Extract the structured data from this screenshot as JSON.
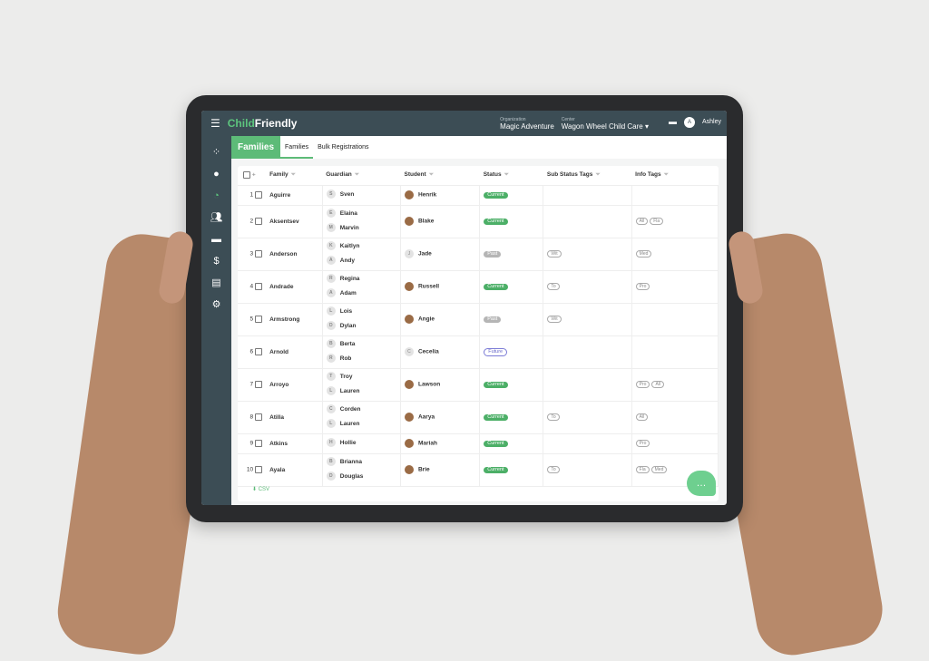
{
  "app": {
    "logo": "ChildFriendly",
    "org_label": "Organization",
    "org": "Magic Adventure",
    "center_label": "Center",
    "center": "Wagon Wheel Child Care",
    "user_initial": "A",
    "user": "Ashley"
  },
  "sidebar": {
    "items": [
      "apps-icon",
      "check-in-icon",
      "reports-icon",
      "people-icon",
      "messages-icon",
      "billing-icon",
      "documents-icon",
      "settings-icon"
    ]
  },
  "subbar": {
    "section": "Families",
    "tabs": [
      "Families",
      "Bulk Registrations"
    ]
  },
  "table": {
    "columns": [
      "Family",
      "Guardian",
      "Student",
      "Status",
      "Sub Status Tags",
      "Info Tags"
    ],
    "rows": [
      {
        "n": "1",
        "family": "Aguirre",
        "guardians": [
          "Sven"
        ],
        "student": "Henrik",
        "photo": true,
        "status": "Current",
        "sub": [],
        "info": []
      },
      {
        "n": "2",
        "family": "Aksentsev",
        "guardians": [
          "Elaina",
          "Marvin"
        ],
        "student": "Blake",
        "photo": true,
        "status": "Current",
        "sub": [],
        "info": [
          "All",
          "Fla"
        ]
      },
      {
        "n": "3",
        "family": "Anderson",
        "guardians": [
          "Kaitlyn",
          "Andy"
        ],
        "student": "Jade",
        "photo": false,
        "status": "Past",
        "sub": [
          "Wit"
        ],
        "info": [
          "Med"
        ]
      },
      {
        "n": "4",
        "family": "Andrade",
        "guardians": [
          "Regina",
          "Adam"
        ],
        "student": "Russell",
        "photo": true,
        "status": "Current",
        "sub": [
          "To"
        ],
        "info": [
          "Pro"
        ]
      },
      {
        "n": "5",
        "family": "Armstrong",
        "guardians": [
          "Lois",
          "Dylan"
        ],
        "student": "Angie",
        "photo": true,
        "status": "Past",
        "sub": [
          "Wit"
        ],
        "info": []
      },
      {
        "n": "6",
        "family": "Arnold",
        "guardians": [
          "Berta",
          "Rob"
        ],
        "student": "Cecelia",
        "photo": false,
        "status": "Future",
        "sub": [],
        "info": []
      },
      {
        "n": "7",
        "family": "Arroyo",
        "guardians": [
          "Troy",
          "Lauren"
        ],
        "student": "Lawson",
        "photo": true,
        "status": "Current",
        "sub": [],
        "info": [
          "Pro",
          "All"
        ]
      },
      {
        "n": "8",
        "family": "Atilla",
        "guardians": [
          "Corden",
          "Lauren"
        ],
        "student": "Aarya",
        "photo": true,
        "status": "Current",
        "sub": [
          "To"
        ],
        "info": [
          "All"
        ]
      },
      {
        "n": "9",
        "family": "Atkins",
        "guardians": [
          "Hollie"
        ],
        "student": "Mariah",
        "photo": true,
        "status": "Current",
        "sub": [],
        "info": [
          "Pro"
        ]
      },
      {
        "n": "10",
        "family": "Ayala",
        "guardians": [
          "Brianna",
          "Douglas"
        ],
        "student": "Brie",
        "photo": true,
        "status": "Current",
        "sub": [
          "To"
        ],
        "info": [
          "Fla",
          "Med"
        ]
      }
    ]
  },
  "footer": {
    "csv": "CSV"
  },
  "colors": {
    "topbar": "#3c4d55",
    "accent": "#5dbb78"
  }
}
